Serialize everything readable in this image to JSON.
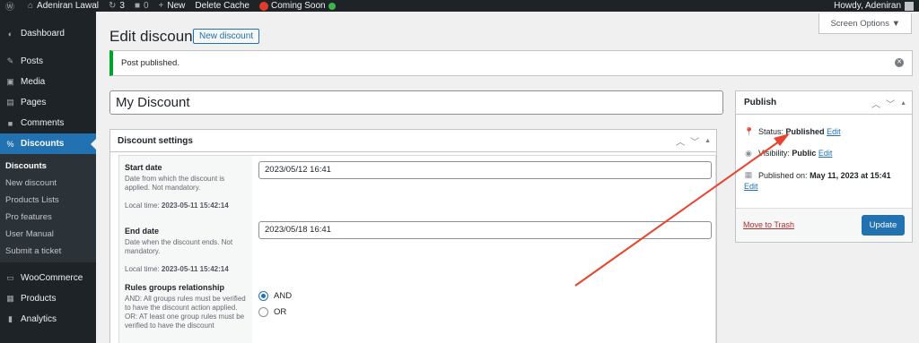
{
  "adminbar": {
    "site_name": "Adeniran Lawal",
    "updates_count": "3",
    "comments_count": "0",
    "new_label": "New",
    "delete_cache_label": "Delete Cache",
    "coming_soon_label": "Coming Soon",
    "howdy": "Howdy, Adeniran"
  },
  "sidebar": {
    "items": [
      {
        "label": "Dashboard",
        "icon": "dashboard-icon"
      },
      {
        "label": "Posts",
        "icon": "pin-icon"
      },
      {
        "label": "Media",
        "icon": "media-icon"
      },
      {
        "label": "Pages",
        "icon": "pages-icon"
      },
      {
        "label": "Comments",
        "icon": "comment-icon"
      },
      {
        "label": "Discounts",
        "icon": "discount-icon"
      }
    ],
    "submenu": [
      "Discounts",
      "New discount",
      "Products Lists",
      "Pro features",
      "User Manual",
      "Submit a ticket"
    ],
    "after": [
      {
        "label": "WooCommerce",
        "icon": "woo-icon"
      },
      {
        "label": "Products",
        "icon": "products-icon"
      },
      {
        "label": "Analytics",
        "icon": "analytics-icon"
      }
    ]
  },
  "header": {
    "title": "Edit discount",
    "new_button": "New discount",
    "screen_options": "Screen Options ▼"
  },
  "notice": {
    "text": "Post published."
  },
  "post_title": "My Discount",
  "discount_settings": {
    "title": "Discount settings",
    "start_date": {
      "label": "Start date",
      "desc": "Date from which the discount is applied. Not mandatory.",
      "local_prefix": "Local time:",
      "local_time": "2023-05-11 15:42:14",
      "value": "2023/05/12 16:41"
    },
    "end_date": {
      "label": "End date",
      "desc": "Date when the discount ends. Not mandatory.",
      "local_prefix": "Local time:",
      "local_time": "2023-05-11 15:42:14",
      "value": "2023/05/18 16:41"
    },
    "rules": {
      "label": "Rules groups relationship",
      "desc": "AND: All groups rules must be verified to have the discount action applied. OR: AT least one group rules must be verified to have the discount",
      "options": [
        "AND",
        "OR"
      ],
      "selected": "AND"
    }
  },
  "publish": {
    "title": "Publish",
    "status_label": "Status:",
    "status_value": "Published",
    "visibility_label": "Visibility:",
    "visibility_value": "Public",
    "published_label": "Published on:",
    "published_value": "May 11, 2023 at 15:41",
    "edit": "Edit",
    "trash": "Move to Trash",
    "update": "Update"
  },
  "colors": {
    "accent": "#2271b1",
    "success": "#00a32a",
    "annotation_arrow": "#e8432e"
  }
}
